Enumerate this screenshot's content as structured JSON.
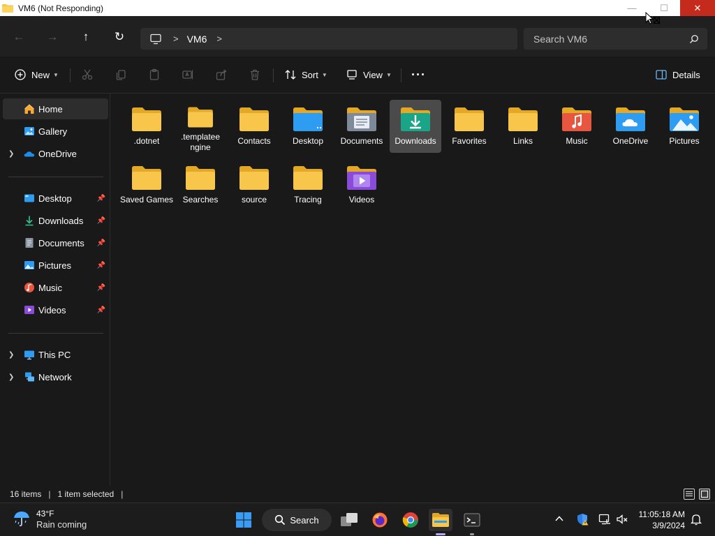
{
  "window": {
    "title": "VM6 (Not Responding)",
    "minimize_glyph": "—",
    "maximize_glyph": "☐",
    "close_glyph": "✕"
  },
  "nav": {
    "back_glyph": "←",
    "forward_glyph": "→",
    "up_glyph": "↑",
    "refresh_glyph": "↻"
  },
  "address": {
    "separator": ">",
    "crumb": "VM6",
    "trailing_separator": ">"
  },
  "search": {
    "placeholder": "Search VM6"
  },
  "toolbar": {
    "new_label": "New",
    "sort_label": "Sort",
    "view_label": "View",
    "more_label": "···",
    "details_label": "Details"
  },
  "sidebar": {
    "top_items": [
      {
        "label": "Home",
        "icon": "home-icon"
      },
      {
        "label": "Gallery",
        "icon": "gallery-icon"
      },
      {
        "label": "OneDrive",
        "icon": "onedrive-icon"
      }
    ],
    "quick_access": [
      {
        "label": "Desktop",
        "icon": "desktop-icon"
      },
      {
        "label": "Downloads",
        "icon": "downloads-icon"
      },
      {
        "label": "Documents",
        "icon": "documents-icon"
      },
      {
        "label": "Pictures",
        "icon": "pictures-icon"
      },
      {
        "label": "Music",
        "icon": "music-icon"
      },
      {
        "label": "Videos",
        "icon": "videos-icon"
      }
    ],
    "bottom_items": [
      {
        "label": "This PC",
        "icon": "this-pc-icon"
      },
      {
        "label": "Network",
        "icon": "network-icon"
      }
    ]
  },
  "folders": [
    {
      "label": ".dotnet",
      "icon": "plain"
    },
    {
      "label": ".templatee ngine",
      "icon": "plain"
    },
    {
      "label": "Contacts",
      "icon": "plain"
    },
    {
      "label": "Desktop",
      "icon": "desktop"
    },
    {
      "label": "Documents",
      "icon": "documents"
    },
    {
      "label": "Downloads",
      "icon": "downloads",
      "selected": true
    },
    {
      "label": "Favorites",
      "icon": "plain"
    },
    {
      "label": "Links",
      "icon": "plain"
    },
    {
      "label": "Music",
      "icon": "music"
    },
    {
      "label": "OneDrive",
      "icon": "onedrive"
    },
    {
      "label": "Pictures",
      "icon": "pictures"
    },
    {
      "label": "Saved Games",
      "icon": "plain"
    },
    {
      "label": "Searches",
      "icon": "plain"
    },
    {
      "label": "source",
      "icon": "plain"
    },
    {
      "label": "Tracing",
      "icon": "plain"
    },
    {
      "label": "Videos",
      "icon": "videos"
    }
  ],
  "status": {
    "item_count": "16 items",
    "selection": "1 item selected"
  },
  "taskbar": {
    "temperature": "43°F",
    "condition": "Rain coming",
    "search_label": "Search",
    "time": "11:05:18 AM",
    "date": "3/9/2024"
  },
  "colors": {
    "folder_yellow": "#f8c64a",
    "folder_yellow_dark": "#e3a825",
    "accent_blue": "#2e9cf0",
    "downloads_teal": "#1aa589",
    "music_red": "#e8563f",
    "videos_purple": "#8a4cd8",
    "close_red": "#c42b1c"
  }
}
